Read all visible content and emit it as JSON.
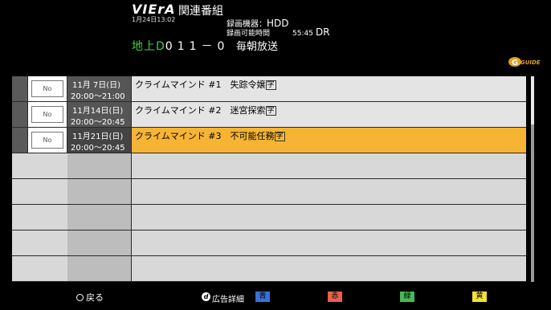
{
  "header": {
    "brand": "VIErA",
    "clock": "1月24日13:02",
    "title": "関連番組",
    "rec_device_label": "録画機器：",
    "rec_device_value": "HDD",
    "rec_time_label": "録画可能時間",
    "rec_time_value": "55:45",
    "rec_mode": "DR",
    "channel_type": "地上D",
    "channel_number": "011－0",
    "station": "毎朝放送",
    "guide_logo": "GUIDE"
  },
  "list": {
    "rows": [
      {
        "thumb": "No Image",
        "date": "11月 7日(日)",
        "time": "20:00〜21:00",
        "title": "クライムマインド #1　失踪令嬢",
        "badge": "字",
        "selected": false
      },
      {
        "thumb": "No Image",
        "date": "11月14日(日)",
        "time": "20:00〜20:45",
        "title": "クライムマインド #2　迷宮探索",
        "badge": "字",
        "selected": false
      },
      {
        "thumb": "No Image",
        "date": "11月21日(日)",
        "time": "20:00〜20:45",
        "title": "クライムマインド #3　不可能任務",
        "badge": "字",
        "selected": true
      }
    ],
    "empty_rows": 5
  },
  "footer": {
    "back_label": "戻る",
    "ad_label": "広告詳細",
    "d_icon": "d",
    "blue": "青",
    "red": "赤",
    "green": "緑",
    "yellow": "黄"
  },
  "colors": {
    "selected_row": "#f5b433",
    "blue_button": "#3a6fd8",
    "red_button": "#e8604a",
    "green_button": "#44bb55",
    "yellow_button": "#f2e03a"
  }
}
